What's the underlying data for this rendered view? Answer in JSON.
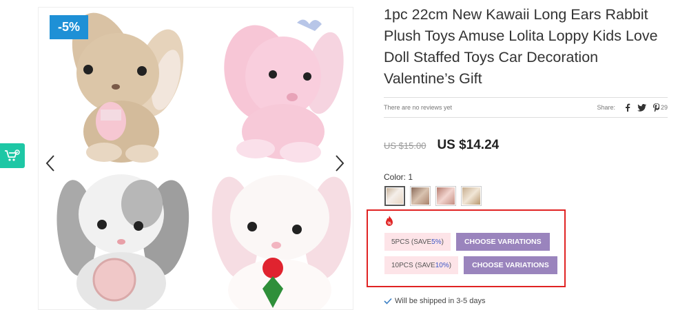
{
  "product": {
    "title": "1pc 22cm New Kawaii Long Ears Rabbit Plush Toys Amuse Lolita Loppy Kids Love Doll Staffed Toys Car Decoration Valentine’s Gift",
    "discount_badge": "-5%",
    "reviews_text": "There are no reviews yet",
    "share_label": "Share:",
    "pinterest_count": "29",
    "old_price": "US $15.00",
    "new_price": "US $14.24",
    "color_label": "Color: 1",
    "swatches": [
      {
        "name": "white-beige",
        "color": "#e8ded0"
      },
      {
        "name": "brown-mix",
        "color": "#b89a88"
      },
      {
        "name": "pink-mix",
        "color": "#c9a093"
      },
      {
        "name": "beige-mix",
        "color": "#d8c3a8"
      }
    ],
    "selected_swatch": 0
  },
  "bundles": [
    {
      "prefix": "5PCS (SAVE ",
      "pct": "5%",
      "suffix": ")",
      "button": "CHOOSE VARIATIONS"
    },
    {
      "prefix": "10PCS (SAVE ",
      "pct": "10%",
      "suffix": ")",
      "button": "CHOOSE VARIATIONS"
    }
  ],
  "shipping_text": "Will be shipped in 3-5 days",
  "icons": {
    "floating_cart": "cart-settings-icon",
    "prev": "chevron-left-icon",
    "next": "chevron-right-icon",
    "facebook": "facebook-icon",
    "twitter": "twitter-icon",
    "pinterest": "pinterest-icon",
    "fire": "fire-percent-icon",
    "check": "check-icon"
  },
  "colors": {
    "badge": "#1e90d6",
    "choose_button": "#9a84bd",
    "bundle_tag_bg": "#fde4e8",
    "highlight_box": "#e02222",
    "float_widget": "#1ec7a5"
  }
}
